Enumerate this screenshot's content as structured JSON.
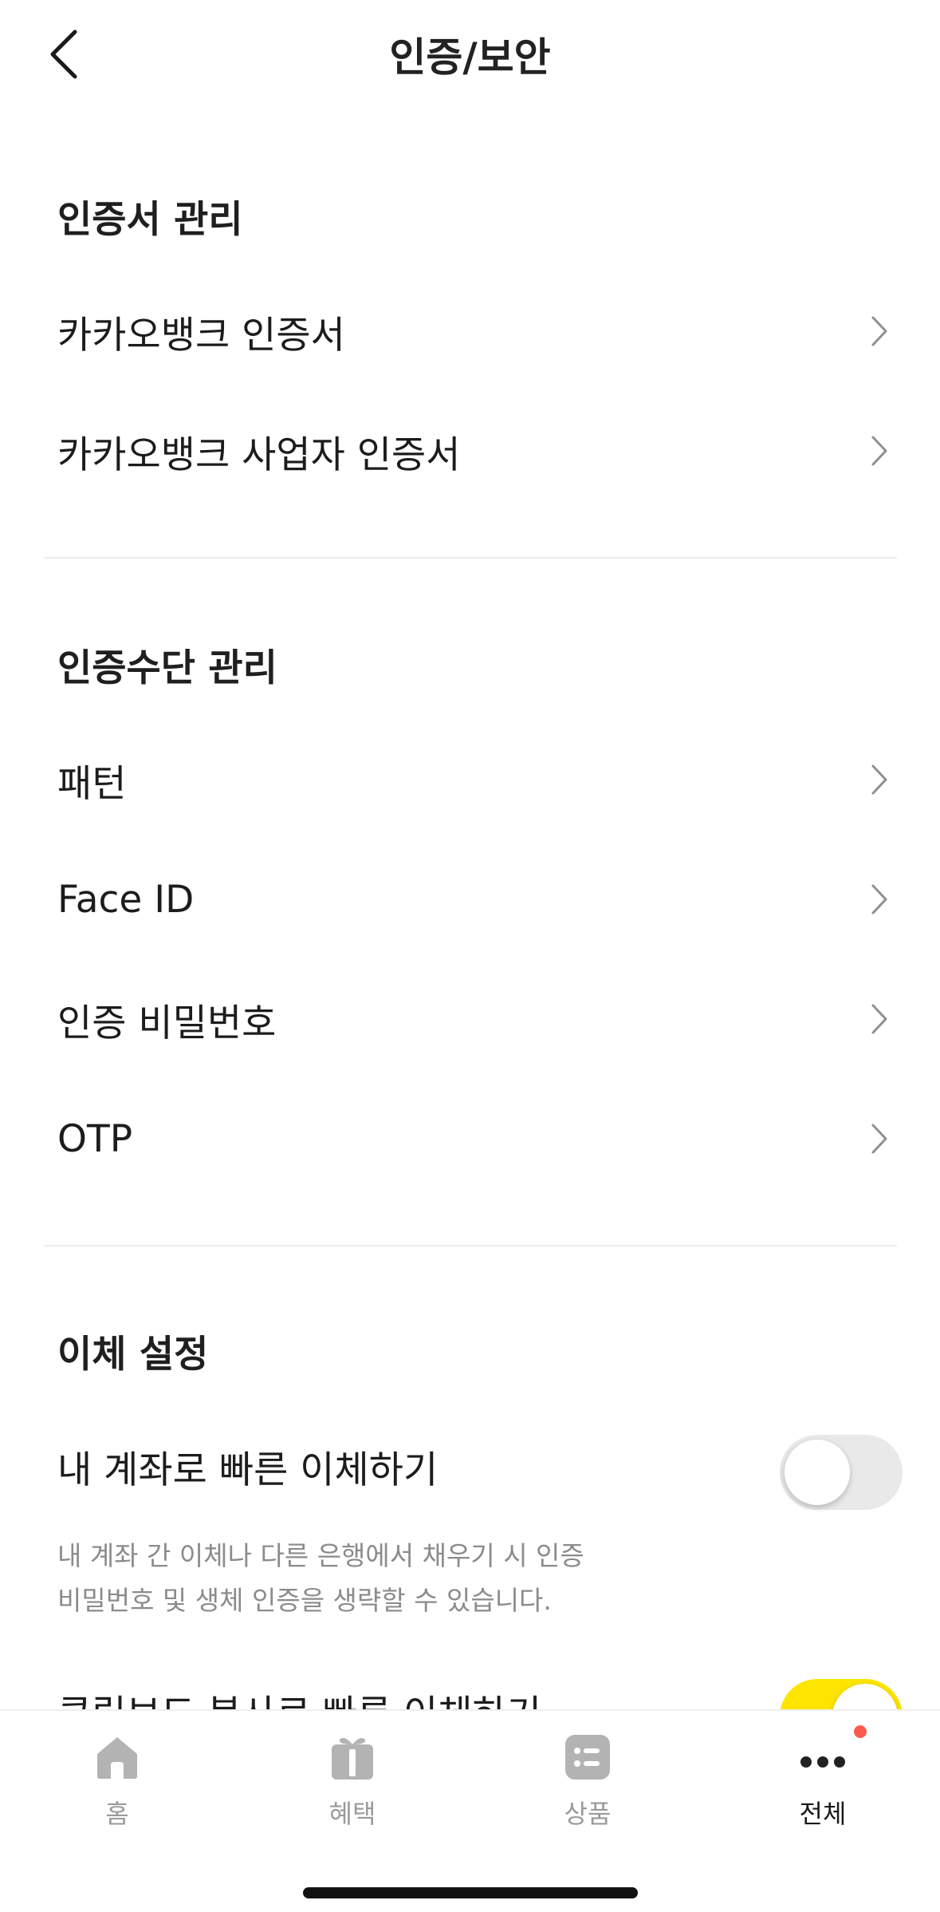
{
  "header": {
    "title": "인증/보안",
    "back_icon": "chevron-left-icon"
  },
  "sections": {
    "certificates": {
      "title": "인증서 관리",
      "items": [
        {
          "label": "카카오뱅크 인증서"
        },
        {
          "label": "카카오뱅크 사업자 인증서"
        }
      ]
    },
    "auth_methods": {
      "title": "인증수단 관리",
      "items": [
        {
          "label": "패턴"
        },
        {
          "label": "Face ID"
        },
        {
          "label": "인증 비밀번호"
        },
        {
          "label": "OTP"
        }
      ]
    },
    "transfer": {
      "title": "이체 설정",
      "quick_own_account": {
        "label": "내 계좌로 빠른 이체하기",
        "enabled": false,
        "desc_line1": "내 계좌 간 이체나 다른 은행에서 채우기 시 인증",
        "desc_line2": "비밀번호 및 생체 인증을 생략할 수 있습니다."
      },
      "clipboard_quick": {
        "label": "클립보드 복사로 빠른 이체하기",
        "enabled": true
      }
    }
  },
  "tabbar": {
    "tabs": [
      {
        "label": "홈",
        "icon": "home-icon",
        "active": false
      },
      {
        "label": "혜택",
        "icon": "gift-icon",
        "active": false
      },
      {
        "label": "상품",
        "icon": "list-icon",
        "active": false
      },
      {
        "label": "전체",
        "icon": "more-dots-icon",
        "active": true,
        "badge": true
      }
    ]
  },
  "colors": {
    "accent": "#fee500",
    "badge": "#ff5a4f",
    "muted": "#8b8b8b"
  }
}
